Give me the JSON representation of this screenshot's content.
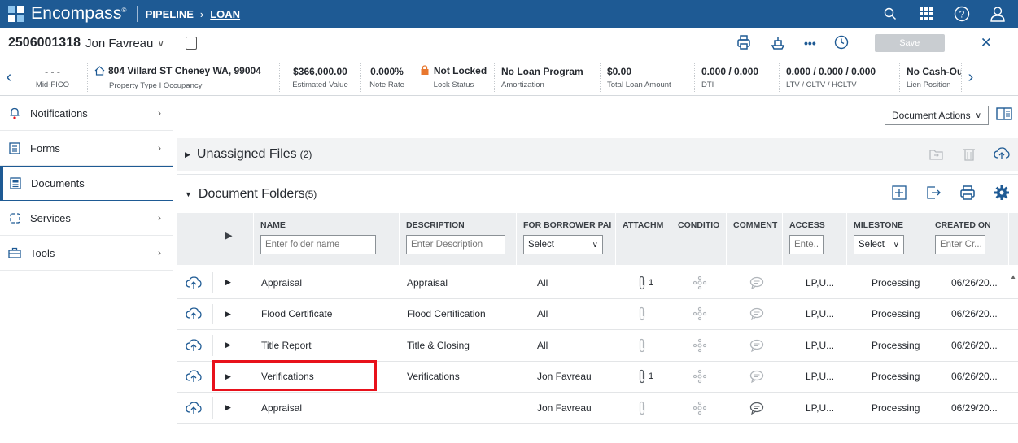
{
  "topbar": {
    "brand": "Encompass",
    "brand_mark": "®",
    "crumb_pipeline": "PIPELINE",
    "crumb_loan": "LOAN",
    "icons": [
      "search-icon",
      "apps-grid-icon",
      "help-icon",
      "user-icon"
    ]
  },
  "loan": {
    "number": "2506001318",
    "borrower": "Jon Favreau",
    "save_label": "Save"
  },
  "summary": [
    {
      "value": "- - -",
      "label": "Mid-FICO"
    },
    {
      "value": "804 Villard ST Cheney WA, 99004",
      "label": "Property Type I Occupancy"
    },
    {
      "value": "$366,000.00",
      "label": "Estimated Value"
    },
    {
      "value": "0.000%",
      "label": "Note Rate"
    },
    {
      "value": "Not Locked",
      "label": "Lock Status"
    },
    {
      "value": "No Loan Program",
      "label": "Amortization"
    },
    {
      "value": "$0.00",
      "label": "Total Loan Amount"
    },
    {
      "value": "0.000 / 0.000",
      "label": "DTI"
    },
    {
      "value": "0.000 / 0.000 / 0.000",
      "label": "LTV / CLTV / HCLTV"
    },
    {
      "value": "No Cash-Ou",
      "label": "Lien Position"
    }
  ],
  "sidebar": {
    "items": [
      {
        "label": "Notifications",
        "icon": "bell-icon"
      },
      {
        "label": "Forms",
        "icon": "form-icon"
      },
      {
        "label": "Documents",
        "icon": "document-icon"
      },
      {
        "label": "Services",
        "icon": "services-icon"
      },
      {
        "label": "Tools",
        "icon": "toolbox-icon"
      }
    ]
  },
  "main": {
    "doc_actions": "Document Actions",
    "unassigned": {
      "title": "Unassigned Files",
      "count": "(2)"
    },
    "folders": {
      "title": "Document Folders",
      "count": "(5)"
    }
  },
  "table": {
    "headers": {
      "name": "NAME",
      "description": "DESCRIPTION",
      "borrower": "FOR BORROWER PAI",
      "attach": "ATTACHM",
      "condition": "CONDITIO",
      "comment": "COMMENT",
      "access": "ACCESS",
      "milestone": "MILESTONE",
      "created": "CREATED ON"
    },
    "filters": {
      "name_placeholder": "Enter folder name",
      "desc_placeholder": "Enter Description",
      "borrower_select": "Select",
      "access_placeholder": "Ente...",
      "milestone_select": "Select",
      "created_placeholder": "Enter Cr..."
    },
    "rows": [
      {
        "name": "Appraisal",
        "description": "Appraisal",
        "borrower": "All",
        "attach_count": "1",
        "access": "LP,U...",
        "milestone": "Processing",
        "created": "06/26/20..."
      },
      {
        "name": "Flood Certificate",
        "description": "Flood Certification",
        "borrower": "All",
        "attach_count": "",
        "access": "LP,U...",
        "milestone": "Processing",
        "created": "06/26/20..."
      },
      {
        "name": "Title Report",
        "description": "Title & Closing",
        "borrower": "All",
        "attach_count": "",
        "access": "LP,U...",
        "milestone": "Processing",
        "created": "06/26/20..."
      },
      {
        "name": "Verifications",
        "description": "Verifications",
        "borrower": "Jon Favreau",
        "attach_count": "1",
        "access": "LP,U...",
        "milestone": "Processing",
        "created": "06/26/20..."
      },
      {
        "name": "Appraisal",
        "description": "",
        "borrower": "Jon Favreau",
        "attach_count": "",
        "access": "LP,U...",
        "milestone": "Processing",
        "created": "06/29/20..."
      }
    ]
  },
  "colors": {
    "brand": "#1e5a94",
    "highlight": "#e8111b",
    "lock": "#e8772e"
  }
}
